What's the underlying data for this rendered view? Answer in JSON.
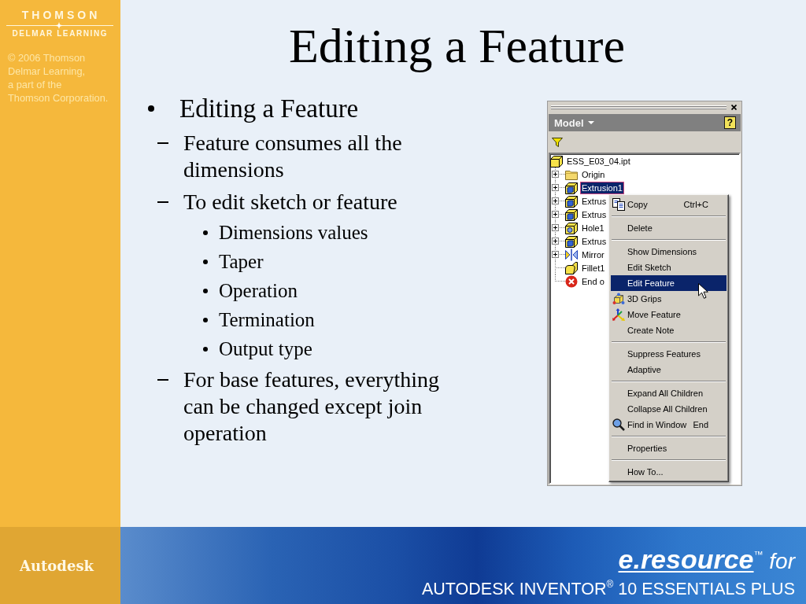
{
  "sidebar": {
    "logo": {
      "wordmark": "THOMSON",
      "subtitle": "DELMAR LEARNING"
    },
    "copyright": "© 2006 Thomson\nDelmar Learning,\na part of the\nThomson Corporation."
  },
  "slide": {
    "title": "Editing a Feature",
    "bullets": [
      {
        "text": "Editing a Feature",
        "children": [
          {
            "text": "Feature consumes all the dimensions"
          },
          {
            "text": "To edit sketch or feature",
            "children": [
              {
                "text": "Dimensions values"
              },
              {
                "text": "Taper"
              },
              {
                "text": "Operation"
              },
              {
                "text": "Termination"
              },
              {
                "text": "Output type"
              }
            ]
          },
          {
            "text": "For base features, everything can be changed except join operation"
          }
        ]
      }
    ]
  },
  "screenshot": {
    "header": {
      "title": "Model",
      "help_label": "?"
    },
    "tree": [
      {
        "label": "ESS_E03_04.ipt",
        "kind": "part",
        "selected": false,
        "children": [
          {
            "label": "Origin",
            "kind": "folder",
            "selected": false,
            "expanded": false
          },
          {
            "label": "Extrusion1",
            "kind": "extrusion",
            "selected": true,
            "expanded": false
          },
          {
            "label": "Extrus",
            "kind": "extrusion",
            "selected": false,
            "expanded": false
          },
          {
            "label": "Extrus",
            "kind": "extrusion",
            "selected": false,
            "expanded": false
          },
          {
            "label": "Hole1",
            "kind": "hole",
            "selected": false,
            "expanded": false
          },
          {
            "label": "Extrus",
            "kind": "extrusion",
            "selected": false,
            "expanded": false
          },
          {
            "label": "Mirror",
            "kind": "mirror",
            "selected": false,
            "expanded": false
          },
          {
            "label": "Fillet1",
            "kind": "fillet",
            "selected": false
          },
          {
            "label": "End o",
            "kind": "end",
            "selected": false
          }
        ]
      }
    ],
    "context_menu": {
      "groups": [
        [
          {
            "label": "Copy",
            "kind": "copy",
            "shortcut": "Ctrl+C",
            "selected": false
          }
        ],
        [
          {
            "label": "Delete",
            "kind": "plain",
            "selected": false
          }
        ],
        [
          {
            "label": "Show Dimensions",
            "kind": "plain",
            "selected": false
          },
          {
            "label": "Edit Sketch",
            "kind": "plain",
            "selected": false
          },
          {
            "label": "Edit Feature",
            "kind": "plain",
            "selected": true
          },
          {
            "label": "3D Grips",
            "kind": "grips",
            "selected": false
          },
          {
            "label": "Move Feature",
            "kind": "move",
            "selected": false
          },
          {
            "label": "Create Note",
            "kind": "plain",
            "selected": false
          }
        ],
        [
          {
            "label": "Suppress Features",
            "kind": "plain",
            "selected": false
          },
          {
            "label": "Adaptive",
            "kind": "plain",
            "selected": false
          }
        ],
        [
          {
            "label": "Expand All Children",
            "kind": "plain",
            "selected": false
          },
          {
            "label": "Collapse All Children",
            "kind": "plain",
            "selected": false
          },
          {
            "label": "Find in Window",
            "kind": "find",
            "shortcut": "End",
            "selected": false
          }
        ],
        [
          {
            "label": "Properties",
            "kind": "plain",
            "selected": false
          }
        ],
        [
          {
            "label": "How To...",
            "kind": "plain",
            "selected": false
          }
        ]
      ]
    }
  },
  "footer": {
    "publisher": "Autodesk",
    "tagline": "**e.resource**$^{™}$ for",
    "product": "AUTODESK INVENTOR$^{®}$ 10 ESSENTIALS PLUS"
  }
}
